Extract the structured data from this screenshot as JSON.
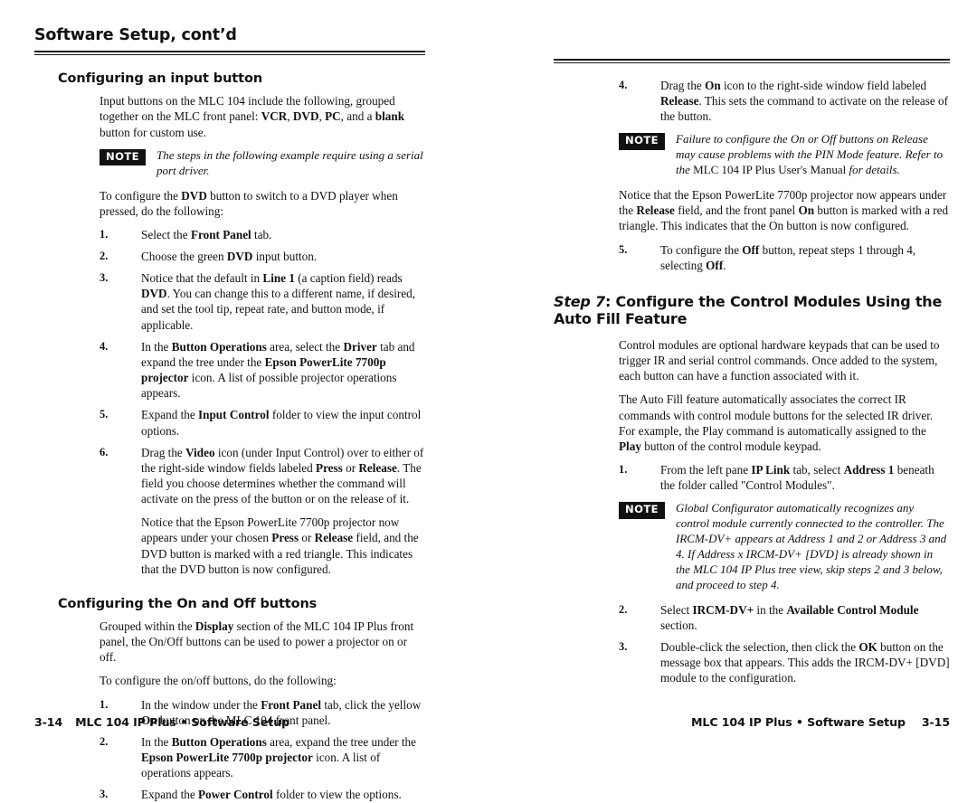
{
  "document": {
    "running_head": "Software Setup, cont’d"
  },
  "left_page": {
    "sections": [
      {
        "heading": "Configuring an input button",
        "blocks": [
          {
            "type": "paragraph",
            "html": "Input buttons on the MLC 104 include the following, grouped together on the MLC front panel: <b>VCR</b>, <b>DVD</b>, <b>PC</b>, and a <b>blank</b> button for custom use."
          },
          {
            "type": "note",
            "tag": "NOTE",
            "html": "The steps in the following example require using a serial port driver."
          },
          {
            "type": "paragraph",
            "html": "To configure the <b>DVD</b> button to switch to a DVD player when pressed, do the following:"
          },
          {
            "type": "list",
            "items": [
              {
                "num": "1.",
                "html": "Select the <b>Front Panel</b> tab."
              },
              {
                "num": "2.",
                "html": "Choose the green <b>DVD</b> input button."
              },
              {
                "num": "3.",
                "html": "Notice that the default in <b>Line 1</b> (a caption field) reads <b>DVD</b>.  You can change this to a different name, if desired, and set the tool tip, repeat rate, and button mode, if applicable."
              },
              {
                "num": "4.",
                "html": "In the <b>Button Operations</b> area, select the <b>Driver</b> tab and expand the tree under the <b>Epson PowerLite 7700p projector</b> icon.  A list of possible projector operations appears."
              },
              {
                "num": "5.",
                "html": "Expand the <b>Input Control</b> folder to view the input control options."
              },
              {
                "num": "6.",
                "html": "Drag the <b>Video</b> icon (under Input Control) over to either of the right-side window fields labeled <b>Press</b> or <b>Release</b>.  The field you choose determines whether the command will activate on the press of the button or on the release of it.",
                "sub": "Notice that the Epson PowerLite 7700p projector now appears under your chosen <b>Press</b> or <b>Release</b> field, and the DVD button is marked with a red triangle.  This indicates that the DVD button is now configured."
              }
            ]
          }
        ]
      },
      {
        "heading": "Configuring the On and Off buttons",
        "blocks": [
          {
            "type": "paragraph",
            "html": "Grouped within the <b>Display</b> section of the MLC 104 IP Plus front panel, the On/Off buttons can be used to power a projector on or off."
          },
          {
            "type": "paragraph",
            "html": "To configure the on/off buttons, do the following:"
          },
          {
            "type": "list",
            "items": [
              {
                "num": "1.",
                "html": "In the window under the <b>Front Panel</b> tab, click the yellow <b>On</b> button on the MLC 104 front panel."
              },
              {
                "num": "2.",
                "html": "In the <b>Button Operations</b> area, expand the tree under the <b>Epson PowerLite 7700p projector</b> icon.  A list of operations appears."
              },
              {
                "num": "3.",
                "html": "Expand the <b>Power Control</b> folder to view the options."
              }
            ]
          }
        ]
      }
    ],
    "footer": {
      "folio": "3-14",
      "text": "MLC 104 IP Plus • Software Setup"
    }
  },
  "right_page": {
    "blocks": [
      {
        "type": "list",
        "items": [
          {
            "num": "4.",
            "html": "Drag the <b>On</b> icon to the right-side window field labeled <b>Release</b>.  This sets the command to activate on the release of the button."
          }
        ]
      },
      {
        "type": "note",
        "tag": "NOTE",
        "html": "Failure to configure the On or Off buttons on Release may cause problems with the PIN Mode feature.  Refer to the <span class=\"roman\">MLC 104 IP Plus User's Manual</span> for details."
      },
      {
        "type": "paragraph",
        "html": "Notice that the Epson PowerLite 7700p projector now appears under the <b>Release</b> field, and the front panel <b>On</b> button is marked with a red triangle.  This indicates that the On button is now configured."
      },
      {
        "type": "list",
        "items": [
          {
            "num": "5.",
            "html": "To configure the <b>Off</b> button, repeat steps 1 through 4, selecting <b>Off</b>."
          }
        ]
      }
    ],
    "step_heading": {
      "step_label": "Step 7",
      "rest": ": Configure the Control Modules Using the Auto Fill Feature"
    },
    "after_heading_blocks": [
      {
        "type": "paragraph",
        "html": "Control modules are optional hardware keypads that can be used to trigger IR and serial control commands.  Once added to the system, each button can have a function associated with it."
      },
      {
        "type": "paragraph",
        "html": "The Auto Fill feature automatically associates the correct IR commands with control module buttons for the selected IR driver.  For example, the Play command is automatically assigned to the <b>Play</b> button of the control module keypad."
      },
      {
        "type": "list",
        "items": [
          {
            "num": "1.",
            "html": "From the left pane <b>IP Link</b> tab, select <b>Address 1</b> beneath the folder called \"Control Modules\"."
          }
        ]
      },
      {
        "type": "note",
        "tag": "NOTE",
        "html": "Global Configurator automatically recognizes any control module currently connected to the controller.  The IRCM-DV+ appears at Address 1 and 2 or Address 3 and 4.  If Address x IRCM-DV+ [DVD] is already shown in the MLC 104 IP Plus tree view, skip steps 2 and 3 below, and proceed to step 4."
      },
      {
        "type": "list",
        "items": [
          {
            "num": "2.",
            "html": "Select <b>IRCM-DV+</b> in the <b>Available Control Module</b> section."
          },
          {
            "num": "3.",
            "html": "Double-click the selection, then click the <b>OK</b> button on the message box that appears.  This adds the IRCM-DV+ [DVD] module to the configuration."
          }
        ]
      }
    ],
    "footer": {
      "folio": "3-15",
      "text": "MLC 104 IP Plus • Software Setup"
    }
  },
  "colors": {
    "page_background": "#ffffff",
    "text": "#111111",
    "note_tag_background": "#111111",
    "note_tag_text": "#ffffff",
    "rule": "#1a1a1a"
  }
}
